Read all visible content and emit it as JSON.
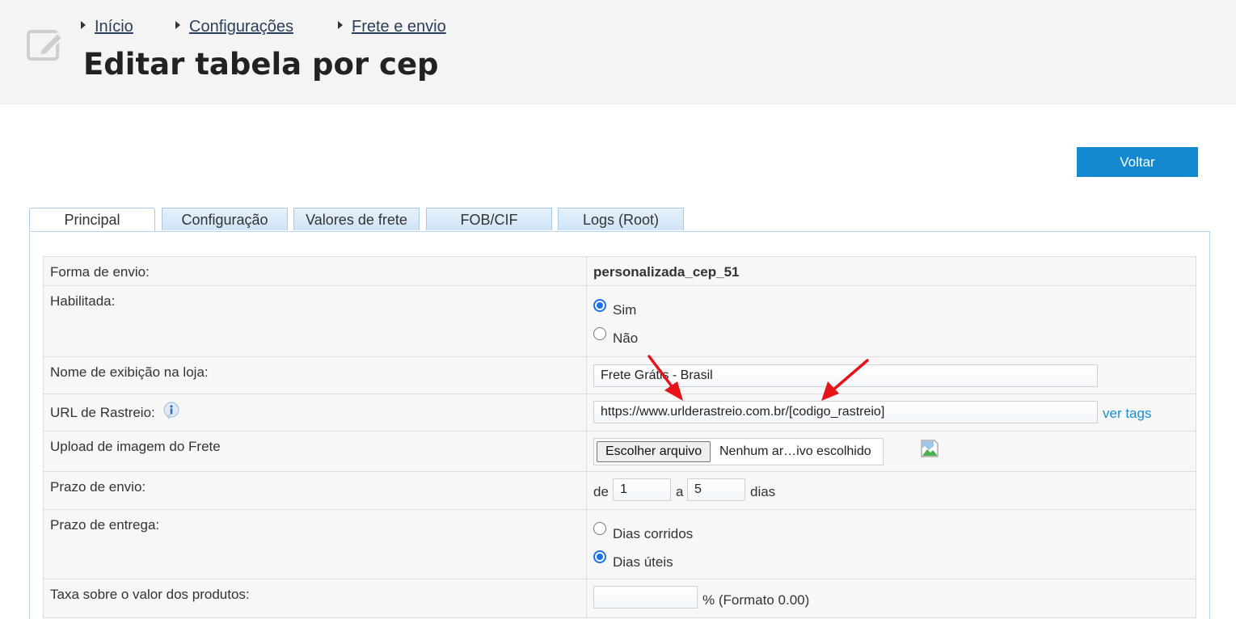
{
  "breadcrumb": {
    "items": [
      {
        "label": "Início"
      },
      {
        "label": "Configurações"
      },
      {
        "label": "Frete e envio"
      }
    ]
  },
  "header": {
    "title": "Editar tabela por cep",
    "icon": "edit-icon"
  },
  "actions": {
    "back_label": "Voltar",
    "back_color": "#1489cf"
  },
  "tabs": [
    {
      "label": "Principal",
      "active": true
    },
    {
      "label": "Configuração",
      "active": false
    },
    {
      "label": "Valores de frete",
      "active": false
    },
    {
      "label": "FOB/CIF",
      "active": false
    },
    {
      "label": "Logs (Root)",
      "active": false
    }
  ],
  "form": {
    "shipping_method": {
      "label": "Forma de envio:",
      "value": "personalizada_cep_51"
    },
    "enabled": {
      "label": "Habilitada:",
      "options": [
        "Sim",
        "Não"
      ],
      "selected": "Sim"
    },
    "display_name": {
      "label": "Nome de exibição na loja:",
      "value": "Frete Grátis - Brasil"
    },
    "tracking_url": {
      "label": "URL de Rastreio:",
      "value": "https://www.urlderastreio.com.br/[codigo_rastreio]",
      "link": "ver tags",
      "icon": "info-icon"
    },
    "image_upload": {
      "label": "Upload de imagem do Frete",
      "button": "Escolher arquivo",
      "status": "Nenhum ar…ivo escolhido",
      "icon": "broken-image-icon"
    },
    "ship_time": {
      "label": "Prazo de envio:",
      "prefix": "de",
      "from": "1",
      "middle": "a",
      "to": "5",
      "suffix": "dias"
    },
    "delivery_time": {
      "label": "Prazo de entrega:",
      "options": [
        "Dias corridos",
        "Dias úteis"
      ],
      "selected": "Dias úteis"
    },
    "product_fee": {
      "label": "Taxa sobre o valor dos produtos:",
      "value": "",
      "suffix": "% (Formato 0.00)"
    }
  },
  "annotation": {
    "arrow_color": "#e8121b",
    "icon": "red-arrow-icon"
  }
}
